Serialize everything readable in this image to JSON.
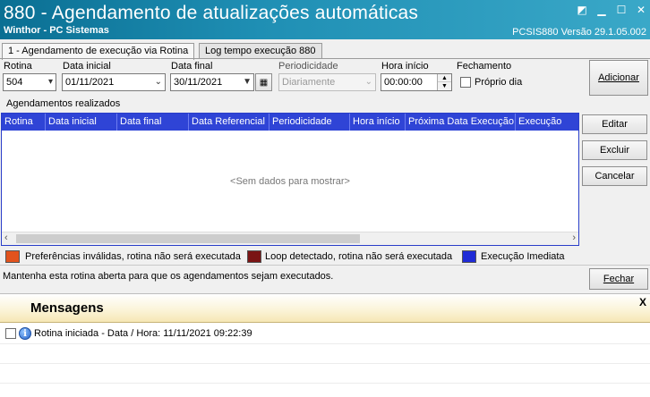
{
  "window": {
    "title": "880 - Agendamento de atualizações automáticas",
    "subtitle": "Winthor - PC Sistemas",
    "version": "PCSIS880  Versão  29.1.05.002"
  },
  "tabs": [
    {
      "label": "1 - Agendamento de execução via Rotina",
      "active": true
    },
    {
      "label": "Log tempo execução 880",
      "active": false
    }
  ],
  "form": {
    "rotina_label": "Rotina",
    "rotina_value": "504",
    "data_inicial_label": "Data inicial",
    "data_inicial_value": "01/11/2021",
    "data_final_label": "Data final",
    "data_final_value": "30/11/2021",
    "periodicidade_label": "Periodicidade",
    "periodicidade_value": "Diariamente",
    "hora_inicio_label": "Hora início",
    "hora_inicio_value": "00:00:00",
    "fechamento_label": "Fechamento",
    "proprio_dia_label": "Próprio dia",
    "adicionar_label": "Adicionar"
  },
  "grid": {
    "section_label": "Agendamentos realizados",
    "columns": [
      "Rotina",
      "Data inicial",
      "Data final",
      "Data Referencial",
      "Periodicidade",
      "Hora início",
      "Próxima Data Execução",
      "Execução"
    ],
    "empty_message": "<Sem dados para mostrar>"
  },
  "side_buttons": {
    "editar": "Editar",
    "excluir": "Excluir",
    "cancelar": "Cancelar"
  },
  "legend": [
    {
      "label": "Preferências inválidas, rotina não será executada",
      "color": "#e2531d"
    },
    {
      "label": "Loop detectado, rotina não será executada",
      "color": "#7a1414"
    },
    {
      "label": "Execução Imediata",
      "color": "#1f2bd6"
    }
  ],
  "status_message": "Mantenha esta rotina aberta para que os agendamentos sejam executados.",
  "fechar_label": "Fechar",
  "messages": {
    "title": "Mensagens",
    "close": "X",
    "items": [
      {
        "text": "Rotina iniciada - Data / Hora: 11/11/2021 09:22:39"
      }
    ]
  }
}
